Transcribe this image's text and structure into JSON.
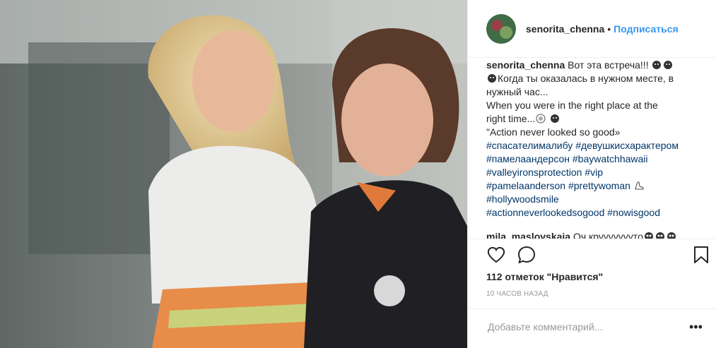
{
  "post": {
    "author": "senorita_chenna",
    "dot": "•",
    "follow_label": "Подписаться"
  },
  "caption": {
    "user": "senorita_chenna",
    "lines": [
      "Вот эта встреча!!!",
      "Когда ты оказалась в нужном месте, в",
      "нужный час...",
      "When you were in the right place at the",
      "right time...",
      "\"Action never looked so good»"
    ],
    "hashtags": [
      "#спасателималибу",
      "#девушкисхарактером",
      "#памелаандерсон",
      "#baywatchhawaii",
      "#valleyironsprotection",
      "#vip",
      "#pamelaanderson",
      "#prettywoman",
      "#hollywoodsmile",
      "#actionneverlookedsogood",
      "#nowisgood"
    ]
  },
  "comments": [
    {
      "user": "mila_maslovskaia",
      "text": "Оч круууууууто"
    }
  ],
  "likes_text": "112 отметок \"Нравится\"",
  "time_text": "10 ЧАСОВ НАЗАД",
  "add_comment": {
    "placeholder": "Добавьте комментарий..."
  },
  "more_label": "•••",
  "icons": {
    "like": "heart-icon",
    "comment": "comment-bubble-icon",
    "save": "bookmark-icon"
  }
}
